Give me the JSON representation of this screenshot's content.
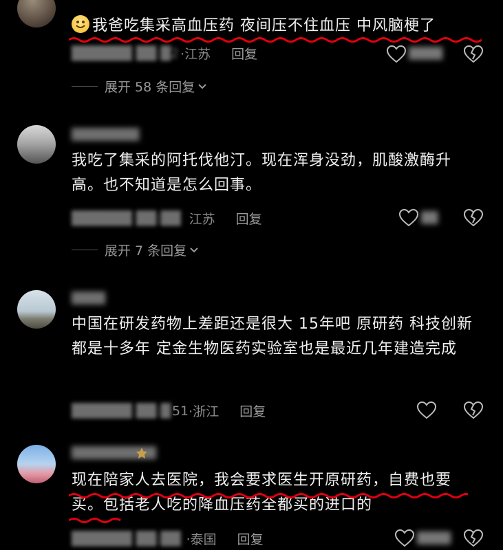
{
  "comments": [
    {
      "username": "",
      "text": "我爸吃集采高血压药 夜间压不住血压 中风脑梗了",
      "date": "2",
      "location": "江苏",
      "reply_label": "回复",
      "likes": "",
      "replies_label": "展开 58 条回复"
    },
    {
      "username": "",
      "text": "我吃了集采的阿托伐他汀。现在浑身没劲，肌酸激酶升高。也不知道是怎么回事。",
      "date": "",
      "location": "江苏",
      "reply_label": "回复",
      "likes": "",
      "replies_label": "展开 7 条回复"
    },
    {
      "username": "",
      "text": "中国在研发药物上差距还是很大 15年吧  原研药 科技创新都是十多年  定金生物医药实验室也是最近几年建造完成",
      "date": "51",
      "location": "浙江",
      "reply_label": "回复",
      "likes": ""
    },
    {
      "username": "",
      "text": "现在陪家人去医院，我会要求医生开原研药，自费也要买。包括老人吃的降血压药全都买的进口的",
      "date": "",
      "location": "泰国",
      "reply_label": "回复",
      "likes": ""
    }
  ],
  "colors": {
    "background": "#000000",
    "underline": "#e00010",
    "text": "#efefef",
    "meta": "#8a8a8a"
  },
  "icons": [
    "heart-icon",
    "broken-heart-icon",
    "chevron-down-icon",
    "smile-emoji-icon",
    "avatar"
  ]
}
